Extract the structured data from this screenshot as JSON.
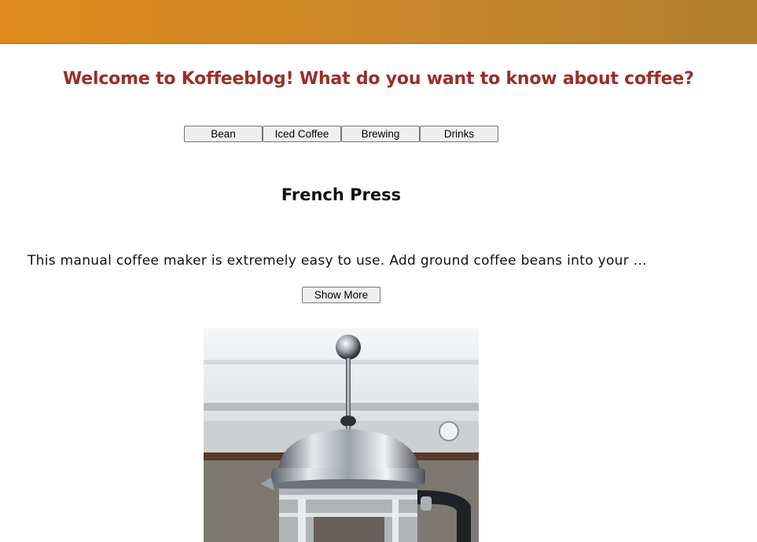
{
  "header": {
    "welcome": "Welcome to Koffeeblog! What do you want to know about coffee?"
  },
  "nav": {
    "items": [
      {
        "label": "Bean"
      },
      {
        "label": "Iced Coffee"
      },
      {
        "label": "Brewing"
      },
      {
        "label": "Drinks"
      }
    ]
  },
  "article": {
    "title": "French Press",
    "excerpt": "This manual coffee maker is extremely easy to use. Add ground coffee beans into your ...",
    "show_more_label": "Show More",
    "image_icon": "french-press-photo"
  },
  "colors": {
    "banner_start": "#e08a1c",
    "banner_end": "#b07f2e",
    "heading": "#9b2d2a"
  }
}
